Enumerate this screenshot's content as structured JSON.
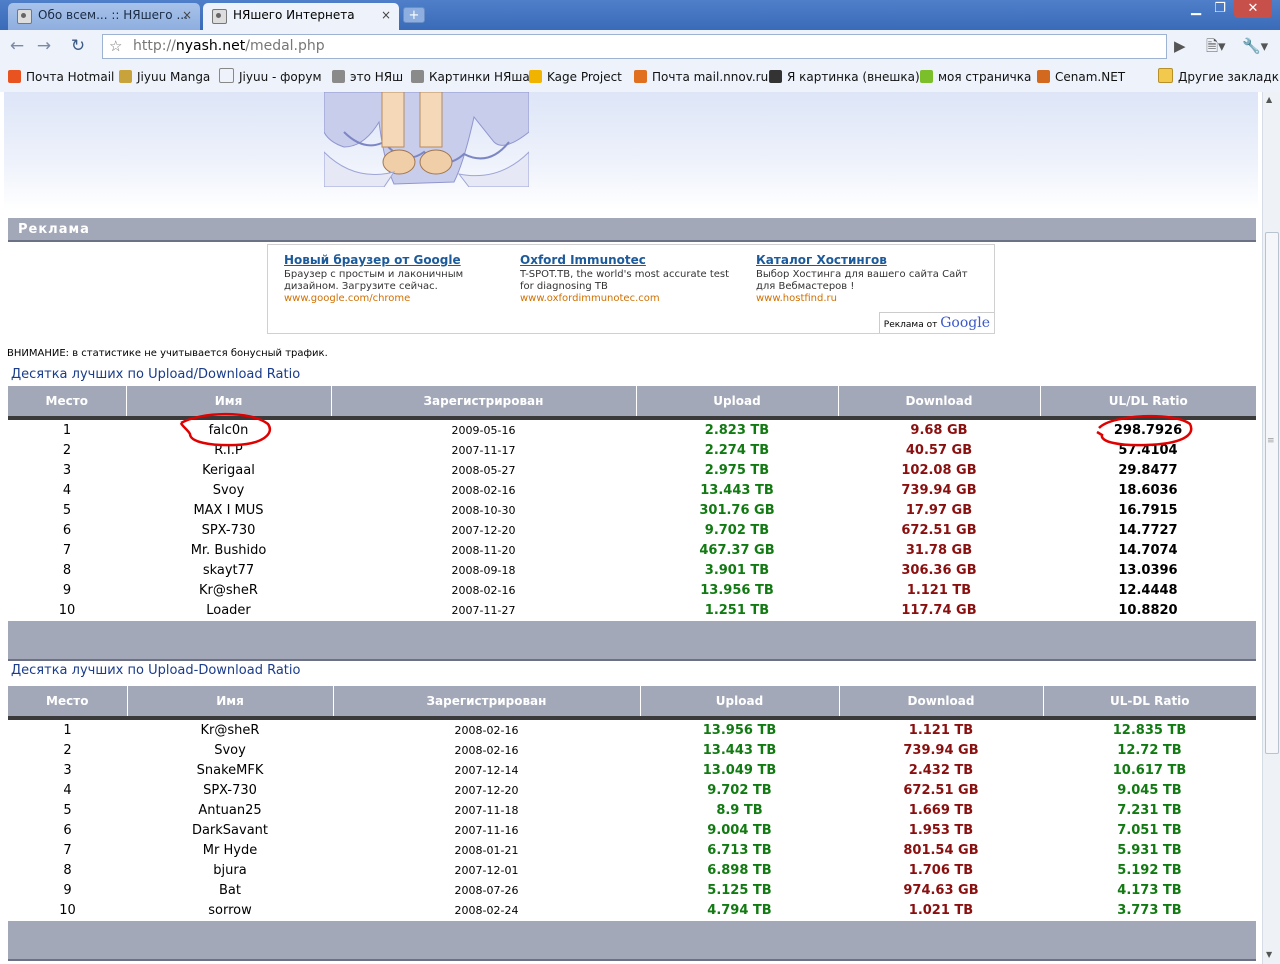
{
  "browser": {
    "tabs": [
      {
        "title": "Обо всем... :: НЯшего ...",
        "active": false
      },
      {
        "title": "НЯшего Интернета",
        "active": true
      }
    ],
    "close_glyph": "×",
    "newtab_glyph": "+",
    "window_controls": {
      "minimize": "▁",
      "maximize": "❐",
      "close": "✕"
    },
    "url": {
      "protocol": "http://",
      "host": "nyash.net",
      "path": "/medal.php"
    },
    "bookmarks": [
      {
        "label": "Почта Hotmail",
        "color": "#e8531f"
      },
      {
        "label": "Jiyuu Manga",
        "color": "#c8a23a"
      },
      {
        "label": "Jiyuu  - форум",
        "color": "#ffffff"
      },
      {
        "label": "это НЯш",
        "color": "#8a8a8a"
      },
      {
        "label": "Картинки НЯша",
        "color": "#8a8a8a"
      },
      {
        "label": "Kage Project",
        "color": "#f0b400"
      },
      {
        "label": "Почта mail.nnov.ru",
        "color": "#e07020"
      },
      {
        "label": "Я картинка (внешка)",
        "color": "#333333"
      },
      {
        "label": "моя страничка",
        "color": "#7bbf2a"
      },
      {
        "label": "Cenam.NET",
        "color": "#d2691e"
      }
    ],
    "other_bookmarks": "Другие закладки"
  },
  "page": {
    "ads_title": "Реклама",
    "ads": [
      {
        "title": "Новый браузер от Google",
        "text": "Браузер с простым и лаконичным дизайном. Загрузите сейчас.",
        "url": "www.google.com/chrome"
      },
      {
        "title": "Oxford Immunotec",
        "text": "T-SPOT.TB, the world's most accurate test for diagnosing TB",
        "url": "www.oxfordimmunotec.com"
      },
      {
        "title": "Каталог Хостингов",
        "text": "Выбор Хостинга для вашего сайта Сайт для Вебмастеров !",
        "url": "www.hostfind.ru"
      }
    ],
    "ads_by": "Реклама от",
    "ads_by_brand": "Google",
    "notice": "ВНИМАНИЕ: в статистике не учитывается бонусный трафик.",
    "table1": {
      "title": "Десятка лучших по Upload/Download Ratio",
      "headers": [
        "Место",
        "Имя",
        "Зарегистрирован",
        "Upload",
        "Download",
        "UL/DL Ratio"
      ],
      "rows": [
        [
          "1",
          "falc0n",
          "2009-05-16",
          "2.823 TB",
          "9.68 GB",
          "298.7926"
        ],
        [
          "2",
          "R.I.P",
          "2007-11-17",
          "2.274 TB",
          "40.57 GB",
          "57.4104"
        ],
        [
          "3",
          "Kerigaal",
          "2008-05-27",
          "2.975 TB",
          "102.08 GB",
          "29.8477"
        ],
        [
          "4",
          "Svoy",
          "2008-02-16",
          "13.443 TB",
          "739.94 GB",
          "18.6036"
        ],
        [
          "5",
          "MAX I MUS",
          "2008-10-30",
          "301.76 GB",
          "17.97 GB",
          "16.7915"
        ],
        [
          "6",
          "SPX-730",
          "2007-12-20",
          "9.702 TB",
          "672.51 GB",
          "14.7727"
        ],
        [
          "7",
          "Mr. Bushido",
          "2008-11-20",
          "467.37 GB",
          "31.78 GB",
          "14.7074"
        ],
        [
          "8",
          "skayt77",
          "2008-09-18",
          "3.901 TB",
          "306.36 GB",
          "13.0396"
        ],
        [
          "9",
          "Kr@sheR",
          "2008-02-16",
          "13.956 TB",
          "1.121 TB",
          "12.4448"
        ],
        [
          "10",
          "Loader",
          "2007-11-27",
          "1.251 TB",
          "117.74 GB",
          "10.8820"
        ]
      ]
    },
    "table2": {
      "title": "Десятка лучших по Upload-Download Ratio",
      "headers": [
        "Место",
        "Имя",
        "Зарегистрирован",
        "Upload",
        "Download",
        "UL-DL Ratio"
      ],
      "rows": [
        [
          "1",
          "Kr@sheR",
          "2008-02-16",
          "13.956 TB",
          "1.121 TB",
          "12.835 TB"
        ],
        [
          "2",
          "Svoy",
          "2008-02-16",
          "13.443 TB",
          "739.94 GB",
          "12.72 TB"
        ],
        [
          "3",
          "SnakeMFK",
          "2007-12-14",
          "13.049 TB",
          "2.432 TB",
          "10.617 TB"
        ],
        [
          "4",
          "SPX-730",
          "2007-12-20",
          "9.702 TB",
          "672.51 GB",
          "9.045 TB"
        ],
        [
          "5",
          "Antuan25",
          "2007-11-18",
          "8.9 TB",
          "1.669 TB",
          "7.231 TB"
        ],
        [
          "6",
          "DarkSavant",
          "2007-11-16",
          "9.004 TB",
          "1.953 TB",
          "7.051 TB"
        ],
        [
          "7",
          "Mr Hyde",
          "2008-01-21",
          "6.713 TB",
          "801.54 GB",
          "5.931 TB"
        ],
        [
          "8",
          "bjura",
          "2007-12-01",
          "6.898 TB",
          "1.706 TB",
          "5.192 TB"
        ],
        [
          "9",
          "Bat",
          "2008-07-26",
          "5.125 TB",
          "974.63 GB",
          "4.173 TB"
        ],
        [
          "10",
          "sorrow",
          "2008-02-24",
          "4.794 TB",
          "1.021 TB",
          "3.773 TB"
        ]
      ]
    }
  },
  "colors": {
    "upload": "#127a12",
    "download": "#8a0f0f",
    "header_bar": "#a3a8b9",
    "link": "#1a3c8a",
    "annotation": "#e00000"
  }
}
